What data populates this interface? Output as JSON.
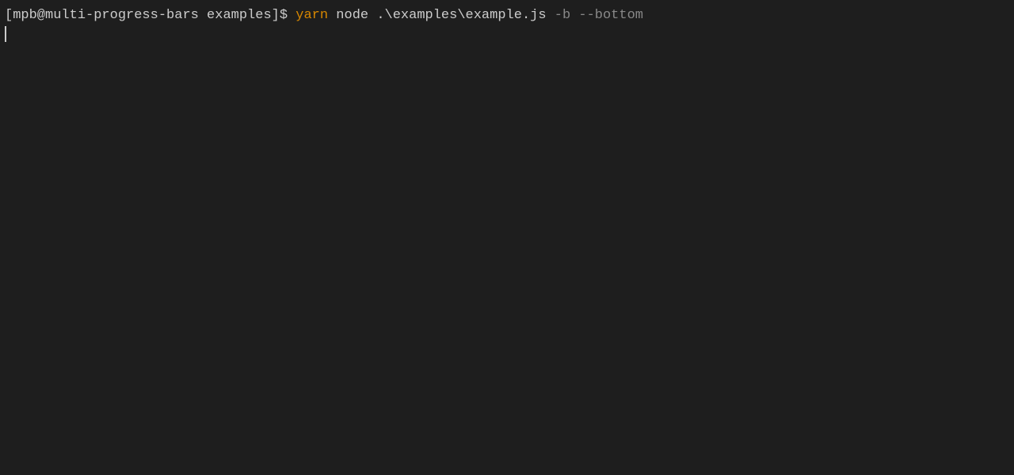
{
  "terminal": {
    "prompt": {
      "open_bracket": "[",
      "user_host": "mpb@multi-progress-bars",
      "directory": "examples",
      "close_bracket": "]",
      "symbol": "$"
    },
    "command": {
      "yarn": "yarn",
      "node": "node",
      "path": ".\\examples\\example.js",
      "flags": "-b --bottom"
    }
  }
}
